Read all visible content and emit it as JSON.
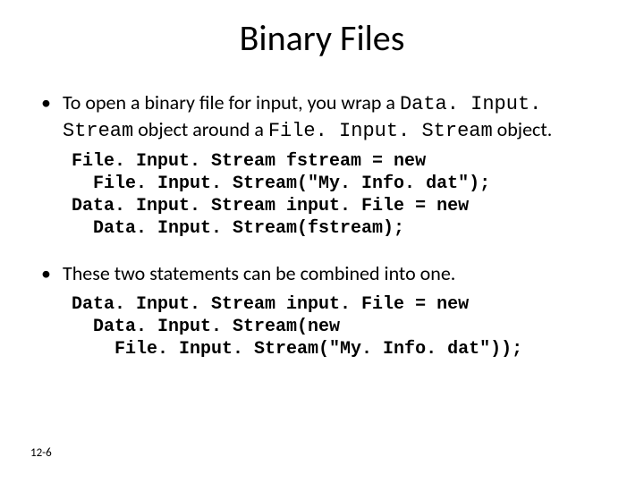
{
  "title": "Binary Files",
  "bullet1": {
    "pre": "To open a binary file for input, you wrap a ",
    "code1": "Data. Input. Stream",
    "mid": " object around a ",
    "code2": "File. Input. Stream",
    "post": " object."
  },
  "code1": "File. Input. Stream fstream = new\n  File. Input. Stream(\"My. Info. dat\");\nData. Input. Stream input. File = new\n  Data. Input. Stream(fstream);",
  "bullet2": "These two statements can be combined into one.",
  "code2": "Data. Input. Stream input. File = new\n  Data. Input. Stream(new\n    File. Input. Stream(\"My. Info. dat\"));",
  "footer": "12-6"
}
